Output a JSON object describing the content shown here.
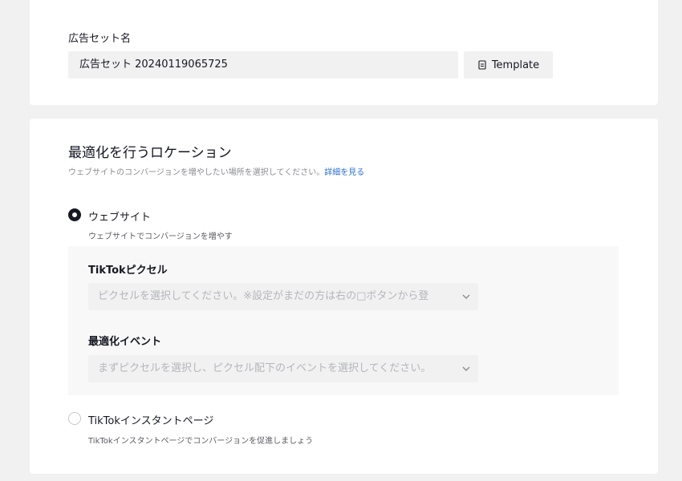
{
  "adset": {
    "label": "広告セット名",
    "name_value": "広告セット 20240119065725",
    "template_label": "Template"
  },
  "location": {
    "title": "最適化を行うロケーション",
    "description": "ウェブサイトのコンバージョンを増やしたい場所を選択してください。",
    "learn_more": "詳細を見る",
    "options": [
      {
        "label": "ウェブサイト",
        "description": "ウェブサイトでコンバージョンを増やす",
        "selected": true
      },
      {
        "label": "TikTokインスタントページ",
        "description": "TikTokインスタントページでコンバージョンを促進しましょう",
        "selected": false
      }
    ],
    "pixel": {
      "label": "TikTokピクセル",
      "placeholder": "ピクセルを選択してください。※設定がまだの方は右の□ボタンから登"
    },
    "event": {
      "label": "最適化イベント",
      "placeholder": "まずピクセルを選択し、ピクセル配下のイベントを選択してください。"
    }
  },
  "icons": {
    "template": "document-icon",
    "dropdown": "chevron-down-icon"
  },
  "colors": {
    "background": "#f1f1f2",
    "card": "#ffffff",
    "panel": "#f8f8f8",
    "text": "#161823",
    "muted": "#8a8b91",
    "placeholder": "#b5b6bb",
    "link": "#2a6fd6"
  }
}
